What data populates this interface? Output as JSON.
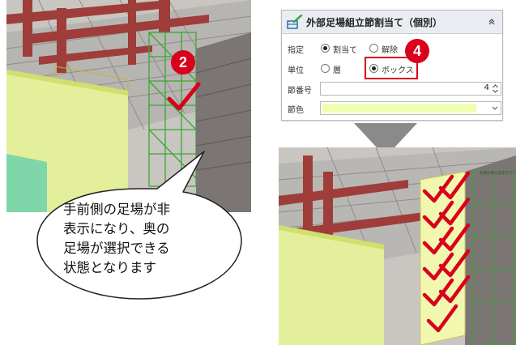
{
  "panel": {
    "title": "外部足場組立節割当て（個別）",
    "rows": {
      "designation": {
        "label": "指定",
        "options": [
          "割当て",
          "解除"
        ],
        "selected": "割当て"
      },
      "unit": {
        "label": "単位",
        "options": [
          "層",
          "ボックス"
        ],
        "selected": "ボックス"
      },
      "section_number": {
        "label": "節番号",
        "value": "4"
      },
      "section_color": {
        "label": "節色",
        "color": "#eeffb0"
      }
    }
  },
  "markers": {
    "step2": "2",
    "step4": "4"
  },
  "callout": {
    "lines": [
      "手前側の足場が非",
      "表示になり、奥の",
      "足場が選択できる",
      "状態となります"
    ]
  },
  "viewport_right": {
    "small_label": "足場の節の設定を行う"
  },
  "colors": {
    "accent_red": "#d9001b",
    "scaffold_green": "#38a832",
    "wall_yellow": "#e3ef9a",
    "steel_red": "#9e3d3a",
    "arrow_gray": "#8a8a8a",
    "panel_header": "#e9edf2"
  }
}
